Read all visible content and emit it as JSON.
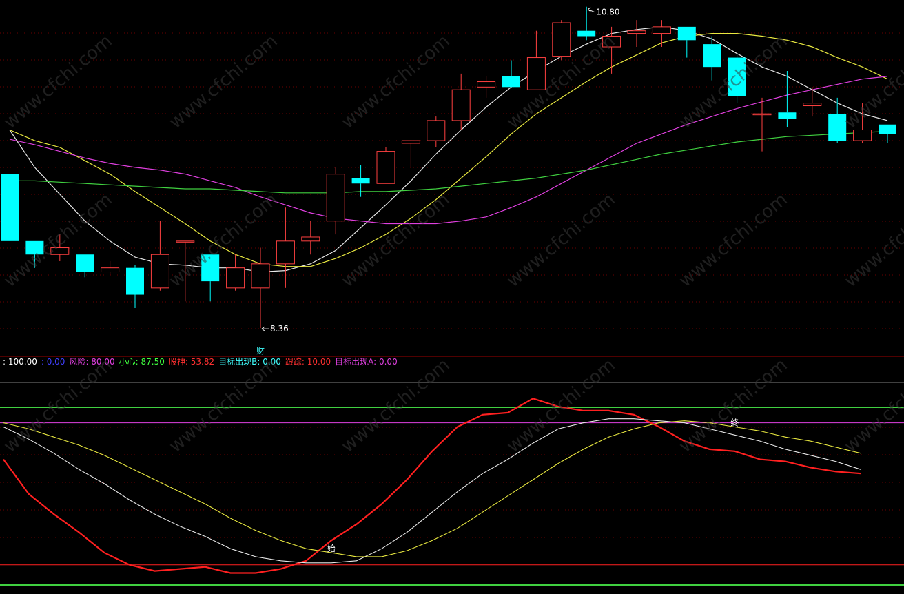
{
  "watermark": "www.cfchi.com",
  "colors": {
    "background": "#000000",
    "up": "#ff4040",
    "down": "#00ffff",
    "ma_white": "#e8e8e8",
    "ma_yellow": "#e8e840",
    "ma_magenta": "#e040e0",
    "ma_green": "#40d040",
    "grid": "#6a0000",
    "red_line": "#ff2020"
  },
  "chart_data": [
    {
      "type": "candlestick",
      "panel": "main",
      "y_range": [
        8.2,
        10.85
      ],
      "grid": true,
      "annotations": {
        "high_label": "10.80",
        "low_label": "8.36",
        "marker": "财"
      },
      "candles": [
        {
          "o": 9.55,
          "h": 9.55,
          "l": 9.05,
          "c": 9.05
        },
        {
          "o": 9.05,
          "h": 9.05,
          "l": 8.85,
          "c": 8.95
        },
        {
          "o": 8.95,
          "h": 9.1,
          "l": 8.9,
          "c": 9.0
        },
        {
          "o": 8.95,
          "h": 8.95,
          "l": 8.78,
          "c": 8.82
        },
        {
          "o": 8.82,
          "h": 8.9,
          "l": 8.8,
          "c": 8.85
        },
        {
          "o": 8.85,
          "h": 8.87,
          "l": 8.55,
          "c": 8.65
        },
        {
          "o": 8.7,
          "h": 9.2,
          "l": 8.68,
          "c": 8.95
        },
        {
          "o": 9.05,
          "h": 9.05,
          "l": 8.6,
          "c": 9.05
        },
        {
          "o": 8.95,
          "h": 8.95,
          "l": 8.6,
          "c": 8.75
        },
        {
          "o": 8.7,
          "h": 8.95,
          "l": 8.68,
          "c": 8.85
        },
        {
          "o": 8.7,
          "h": 9.0,
          "l": 8.4,
          "c": 8.88
        },
        {
          "o": 8.88,
          "h": 9.3,
          "l": 8.7,
          "c": 9.05
        },
        {
          "o": 9.05,
          "h": 9.2,
          "l": 8.95,
          "c": 9.08
        },
        {
          "o": 9.2,
          "h": 9.6,
          "l": 9.1,
          "c": 9.55
        },
        {
          "o": 9.52,
          "h": 9.62,
          "l": 9.38,
          "c": 9.48
        },
        {
          "o": 9.48,
          "h": 9.75,
          "l": 9.48,
          "c": 9.72
        },
        {
          "o": 9.78,
          "h": 9.8,
          "l": 9.6,
          "c": 9.8
        },
        {
          "o": 9.8,
          "h": 9.98,
          "l": 9.75,
          "c": 9.95
        },
        {
          "o": 9.95,
          "h": 10.3,
          "l": 9.88,
          "c": 10.18
        },
        {
          "o": 10.2,
          "h": 10.28,
          "l": 10.12,
          "c": 10.24
        },
        {
          "o": 10.28,
          "h": 10.4,
          "l": 10.2,
          "c": 10.2
        },
        {
          "o": 10.18,
          "h": 10.62,
          "l": 10.18,
          "c": 10.42
        },
        {
          "o": 10.43,
          "h": 10.7,
          "l": 10.4,
          "c": 10.68
        },
        {
          "o": 10.62,
          "h": 10.8,
          "l": 10.55,
          "c": 10.58
        },
        {
          "o": 10.5,
          "h": 10.65,
          "l": 10.3,
          "c": 10.58
        },
        {
          "o": 10.6,
          "h": 10.7,
          "l": 10.5,
          "c": 10.62
        },
        {
          "o": 10.6,
          "h": 10.7,
          "l": 10.5,
          "c": 10.65
        },
        {
          "o": 10.65,
          "h": 10.65,
          "l": 10.42,
          "c": 10.55
        },
        {
          "o": 10.52,
          "h": 10.58,
          "l": 10.25,
          "c": 10.35
        },
        {
          "o": 10.42,
          "h": 10.45,
          "l": 10.08,
          "c": 10.13
        },
        {
          "o": 10.0,
          "h": 10.12,
          "l": 9.72,
          "c": 10.0
        },
        {
          "o": 10.01,
          "h": 10.32,
          "l": 9.9,
          "c": 9.96
        },
        {
          "o": 10.06,
          "h": 10.2,
          "l": 9.98,
          "c": 10.08
        },
        {
          "o": 10.0,
          "h": 10.12,
          "l": 9.78,
          "c": 9.8
        },
        {
          "o": 9.8,
          "h": 10.08,
          "l": 9.78,
          "c": 9.88
        },
        {
          "o": 9.92,
          "h": 9.92,
          "l": 9.78,
          "c": 9.85
        }
      ],
      "series": [
        {
          "color": "ma_white",
          "values": [
            9.88,
            9.6,
            9.4,
            9.2,
            9.05,
            8.93,
            8.88,
            8.87,
            8.85,
            8.85,
            8.82,
            8.83,
            8.88,
            8.98,
            9.15,
            9.32,
            9.5,
            9.7,
            9.88,
            10.05,
            10.2,
            10.32,
            10.43,
            10.52,
            10.6,
            10.63,
            10.65,
            10.62,
            10.56,
            10.45,
            10.35,
            10.28,
            10.18,
            10.08,
            10.0,
            9.95
          ]
        },
        {
          "color": "ma_yellow",
          "values": [
            9.88,
            9.8,
            9.75,
            9.65,
            9.55,
            9.42,
            9.3,
            9.18,
            9.05,
            8.95,
            8.88,
            8.86,
            8.86,
            8.92,
            9.0,
            9.1,
            9.22,
            9.36,
            9.52,
            9.68,
            9.85,
            10.0,
            10.12,
            10.24,
            10.35,
            10.44,
            10.53,
            10.58,
            10.6,
            10.6,
            10.58,
            10.55,
            10.5,
            10.42,
            10.35,
            10.26
          ]
        },
        {
          "color": "ma_magenta",
          "values": [
            9.81,
            9.77,
            9.72,
            9.67,
            9.63,
            9.6,
            9.58,
            9.55,
            9.5,
            9.45,
            9.38,
            9.32,
            9.26,
            9.22,
            9.2,
            9.18,
            9.18,
            9.18,
            9.2,
            9.23,
            9.3,
            9.38,
            9.48,
            9.58,
            9.68,
            9.78,
            9.85,
            9.92,
            9.98,
            10.04,
            10.09,
            10.14,
            10.18,
            10.22,
            10.26,
            10.28
          ]
        },
        {
          "color": "ma_green",
          "values": [
            9.5,
            9.5,
            9.49,
            9.48,
            9.47,
            9.46,
            9.45,
            9.44,
            9.44,
            9.43,
            9.42,
            9.41,
            9.41,
            9.41,
            9.42,
            9.42,
            9.43,
            9.44,
            9.46,
            9.48,
            9.5,
            9.52,
            9.55,
            9.58,
            9.62,
            9.66,
            9.7,
            9.73,
            9.76,
            9.79,
            9.81,
            9.83,
            9.84,
            9.85,
            9.86,
            9.87
          ]
        }
      ]
    },
    {
      "type": "line",
      "panel": "indicator",
      "y_range": [
        -3,
        105
      ],
      "legend": [
        {
          "label": ": ",
          "value": "100.00",
          "color": "#ffffff"
        },
        {
          "label": ": ",
          "value": "0.00",
          "color": "#4040ff"
        },
        {
          "label": "风险: ",
          "value": "80.00",
          "color": "#e040e0"
        },
        {
          "label": "小心: ",
          "value": "87.50",
          "color": "#40ff40"
        },
        {
          "label": "股神: ",
          "value": "53.82",
          "color": "#ff3030"
        },
        {
          "label": "目标出现B: ",
          "value": "0.00",
          "color": "#40ffff"
        },
        {
          "label": "跟踪: ",
          "value": "10.00",
          "color": "#ff3030"
        },
        {
          "label": "目标出现A: ",
          "value": "0.00",
          "color": "#e040e0"
        }
      ],
      "levels": [
        {
          "y": 100,
          "color": "#ffffff"
        },
        {
          "y": 87.5,
          "color": "#40d040"
        },
        {
          "y": 80,
          "color": "#e040e0"
        },
        {
          "y": 10,
          "color": "#ff2020"
        },
        {
          "y": 0,
          "color": "#40d040"
        }
      ],
      "markers": [
        {
          "text": "始",
          "index": 13
        },
        {
          "text": "终",
          "index": 29
        }
      ],
      "series": [
        {
          "color": "red_line",
          "width": 2.2,
          "values": [
            62,
            45,
            35,
            26,
            16,
            10,
            7,
            8,
            9,
            6,
            6,
            8,
            12,
            22,
            30,
            40,
            52,
            66,
            78,
            84,
            85,
            92,
            88,
            86,
            86,
            84,
            78,
            71,
            67,
            66,
            62,
            61,
            58,
            56,
            55
          ]
        },
        {
          "color": "ma_white",
          "values": [
            78,
            72,
            65,
            57,
            50,
            42,
            35,
            29,
            24,
            18,
            14,
            12,
            11,
            11,
            12,
            18,
            26,
            36,
            46,
            55,
            62,
            70,
            77,
            80,
            82,
            82,
            81,
            80,
            77,
            74,
            71,
            67,
            64,
            61,
            57
          ]
        },
        {
          "color": "ma_yellow",
          "values": [
            80,
            77,
            73,
            69,
            64,
            58,
            52,
            46,
            40,
            33,
            27,
            22,
            18,
            16,
            14,
            14,
            17,
            22,
            28,
            36,
            44,
            52,
            60,
            67,
            73,
            77,
            80,
            81,
            80,
            78,
            76,
            73,
            71,
            68,
            65
          ]
        }
      ]
    }
  ]
}
